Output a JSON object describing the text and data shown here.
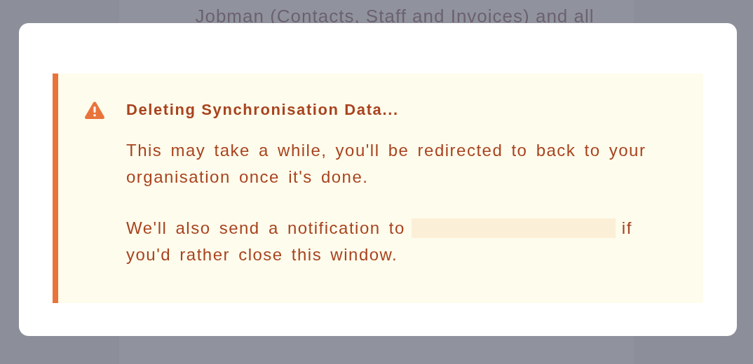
{
  "background": {
    "text": "Jobman (Contacts, Staff and Invoices) and all"
  },
  "alert": {
    "kind": "warning",
    "title": "Deleting Synchronisation Data...",
    "paragraphs": [
      {
        "lines": [
          "This may take a while, you'll be redirected to back to your",
          "organisation once it's done."
        ]
      },
      {
        "before": "We'll also send a notification to",
        "redacted": true,
        "after_lines": [
          "if",
          "you'd rather close this window."
        ]
      }
    ]
  }
}
